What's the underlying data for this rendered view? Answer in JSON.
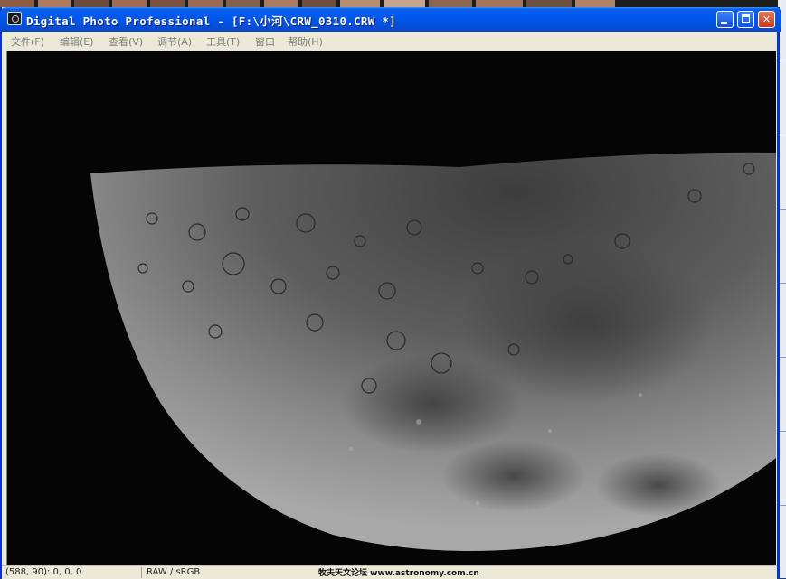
{
  "window": {
    "title": "Digital Photo Professional - [F:\\小河\\CRW_0310.CRW *]",
    "minimize_label": "",
    "maximize_label": "",
    "close_label": "✕"
  },
  "menu": [
    {
      "label": "文件(F)"
    },
    {
      "label": "编辑(E)"
    },
    {
      "label": "查看(V)"
    },
    {
      "label": "调节(A)"
    },
    {
      "label": "工具(T)"
    },
    {
      "label": "窗口"
    },
    {
      "label": "帮助(H)"
    }
  ],
  "status": {
    "cursor": "(588, 90): 0, 0, 0",
    "mode": "RAW / sRGB",
    "watermark": "牧夫天文论坛 www.astronomy.com.cn"
  },
  "colors": {
    "title_blue": "#0058ee",
    "menu_bg": "#ece9d8",
    "close_red": "#c43a1c"
  },
  "icons": {
    "app": "camera-app-icon",
    "minimize": "minimize-icon",
    "maximize": "maximize-icon",
    "close": "close-icon"
  }
}
